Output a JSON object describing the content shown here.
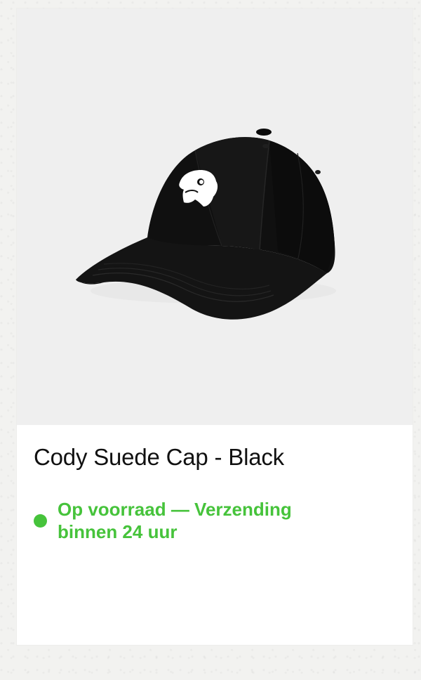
{
  "product": {
    "title": "Cody Suede Cap - Black",
    "image_alt": "product-photo",
    "stock_status": "Op voorraad — Verzending binnen 24 uur"
  },
  "colors": {
    "stock_green": "#46c33b",
    "card_background": "#ffffff",
    "image_background": "#efefef",
    "page_background": "#f2f2f0"
  }
}
